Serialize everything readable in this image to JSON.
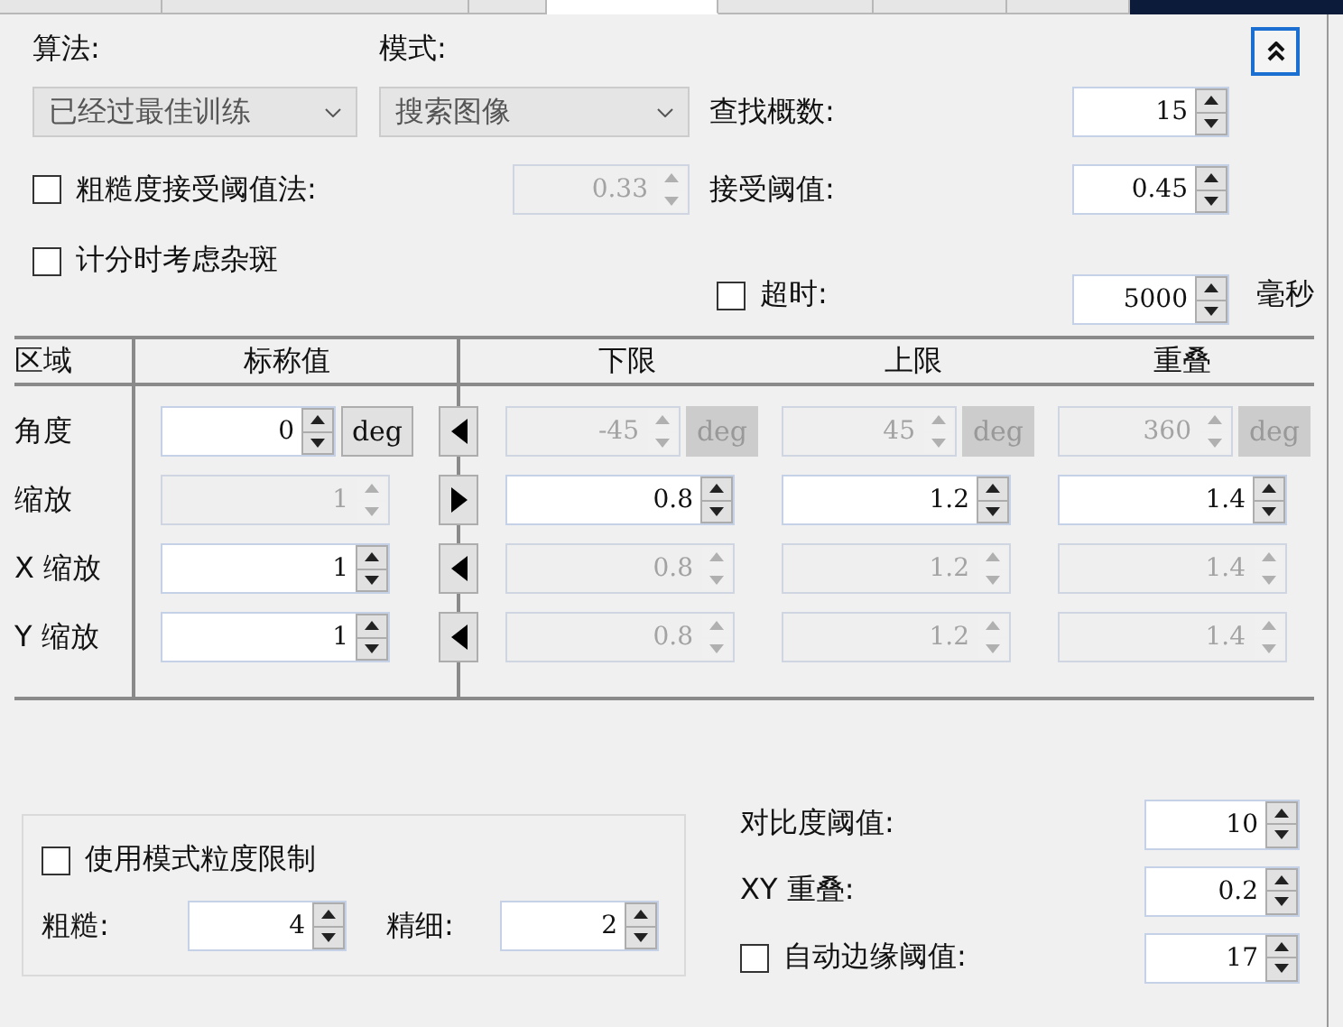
{
  "tabs": [
    {
      "selected": false
    },
    {
      "selected": false
    },
    {
      "selected": false
    },
    {
      "selected": true
    },
    {
      "selected": false
    },
    {
      "selected": false
    },
    {
      "selected": false
    }
  ],
  "algorithm": {
    "label": "算法:",
    "value": "已经过最佳训练"
  },
  "mode": {
    "label": "模式:",
    "value": "搜索图像"
  },
  "coarse_threshold": {
    "label": "粗糙度接受阈值法:",
    "checked": false,
    "value": "0.33",
    "disabled": true
  },
  "clutter": {
    "label": "计分时考虑杂斑",
    "checked": false
  },
  "right_fields": [
    {
      "kind": "plain",
      "label": "查找概数:",
      "value": "15"
    },
    {
      "kind": "plain",
      "label": "接受阈值:",
      "value": "0.45"
    },
    {
      "kind": "checkbox",
      "label": "超时:",
      "checked": false,
      "value": "5000",
      "unit": "毫秒"
    }
  ],
  "table": {
    "columns": [
      "区域",
      "标称值",
      "下限",
      "上限",
      "重叠"
    ],
    "rows": [
      {
        "label": "角度",
        "kind": "left",
        "nominal": {
          "value": "0",
          "disabled": false,
          "unit": "deg"
        },
        "lower": {
          "value": "-45",
          "disabled": true,
          "unit": "deg"
        },
        "upper": {
          "value": "45",
          "disabled": true,
          "unit": "deg"
        },
        "overlap": {
          "value": "360",
          "disabled": true,
          "unit": "deg"
        }
      },
      {
        "label": "缩放",
        "kind": "right",
        "nominal": {
          "value": "1",
          "disabled": true
        },
        "lower": {
          "value": "0.8",
          "disabled": false
        },
        "upper": {
          "value": "1.2",
          "disabled": false
        },
        "overlap": {
          "value": "1.4",
          "disabled": false
        }
      },
      {
        "label": "X 缩放",
        "kind": "left",
        "nominal": {
          "value": "1",
          "disabled": false
        },
        "lower": {
          "value": "0.8",
          "disabled": true
        },
        "upper": {
          "value": "1.2",
          "disabled": true
        },
        "overlap": {
          "value": "1.4",
          "disabled": true
        }
      },
      {
        "label": "Y 缩放",
        "kind": "left",
        "nominal": {
          "value": "1",
          "disabled": false
        },
        "lower": {
          "value": "0.8",
          "disabled": true
        },
        "upper": {
          "value": "1.2",
          "disabled": true
        },
        "overlap": {
          "value": "1.4",
          "disabled": true
        }
      }
    ]
  },
  "granularity": {
    "label": "使用模式粒度限制",
    "checked": false,
    "fields": [
      {
        "label": "粗糙:",
        "value": "4"
      },
      {
        "label": "精细:",
        "value": "2"
      }
    ]
  },
  "contrast_fields": [
    {
      "kind": "plain",
      "label": "对比度阈值:",
      "value": "10"
    },
    {
      "kind": "plain",
      "label": "XY 重叠:",
      "value": "0.2"
    },
    {
      "kind": "checkbox",
      "label": "自动边缘阈值:",
      "checked": false,
      "value": "17"
    }
  ]
}
